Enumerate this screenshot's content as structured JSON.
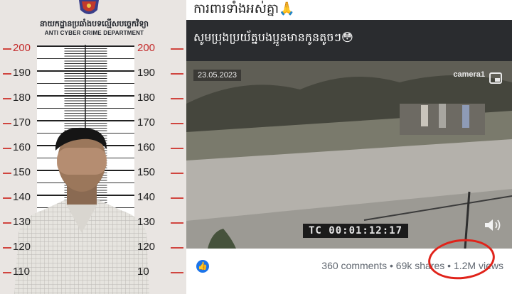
{
  "left_panel": {
    "department_khmer": "នាយកដ្ឋានប្រឆាំងបទល្មើសបច្ចេកវិទ្យា",
    "department_english": "ANTI CYBER CRIME DEPARTMENT",
    "height_labels": [
      "200",
      "190",
      "180",
      "170",
      "160",
      "150",
      "140",
      "130",
      "120",
      "110"
    ],
    "height_labels_right": [
      "200",
      "190",
      "180",
      "170",
      "160",
      "150",
      "140",
      "130",
      "120",
      "10"
    ]
  },
  "post": {
    "caption": "ការពារទាំងអស់គ្នា🙏",
    "card_title": "សូមប្រុងប្រយ័ត្នបងប្អូនមានកូនតូចៗ😳",
    "video": {
      "date_stamp": "23.05.2023",
      "camera_label": "camera1",
      "timecode": "TC 00:01:12:17"
    },
    "stats": {
      "comments": "360 comments",
      "shares": "69k shares",
      "views": "1.2M views",
      "separator": " • "
    }
  },
  "colors": {
    "highlight_circle": "#e0231a",
    "like_blue": "#1c74e9",
    "ruler_red": "#d0453f"
  },
  "icons": [
    "police-badge-icon",
    "like-icon",
    "picture-in-picture-icon",
    "speaker-icon"
  ]
}
